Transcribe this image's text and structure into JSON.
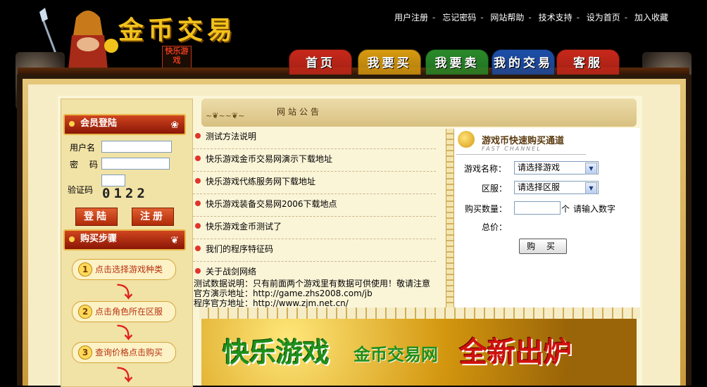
{
  "header": {
    "logo_title": "金币交易",
    "logo_badge": "快乐游戏",
    "top_links": [
      "用户注册",
      "忘记密码",
      "网站帮助",
      "技术支持",
      "设为首页",
      "加入收藏"
    ],
    "nav_tabs": [
      {
        "label": "首页",
        "color": "#c8281a"
      },
      {
        "label": "我要买",
        "color": "#d89a10"
      },
      {
        "label": "我要卖",
        "color": "#2a8a2a"
      },
      {
        "label": "我的交易",
        "color": "#1d4fa8"
      },
      {
        "label": "客服",
        "color": "#c8281a"
      }
    ]
  },
  "login": {
    "title": "会员登陆",
    "username_label": "用户名",
    "password_label": "密 码",
    "captcha_label": "验证码",
    "captcha_value": "0122",
    "login_button": "登陆",
    "register_button": "注册"
  },
  "steps": {
    "title": "购买步骤",
    "items": [
      {
        "num": "1",
        "text": "点击选择游戏种类"
      },
      {
        "num": "2",
        "text": "点击角色所在区服"
      },
      {
        "num": "3",
        "text": "查询价格点击购买"
      }
    ]
  },
  "notice": {
    "title": "网站公告",
    "items": [
      "测试方法说明",
      "快乐游戏金币交易网演示下载地址",
      "快乐游戏代练服务网下载地址",
      "快乐游戏装备交易网2006下载地点",
      "快乐游戏金币测试了",
      "我们的程序特征码",
      "关于战剑网络"
    ],
    "note_lines": [
      "测试数据说明：只有前面两个游戏里有数据可供使用！敬请注意",
      "官方演示地址：http://game.zhs2008.com/jb",
      "程序官方地址：http://www.zjm.net.cn/"
    ]
  },
  "quick_buy": {
    "title": "游戏币快速购买通道",
    "subtitle": "FAST CHANNEL",
    "game_label": "游戏名称：",
    "game_value": "请选择游戏",
    "server_label": "区服：",
    "server_value": "请选择区服",
    "quantity_label": "购买数量：",
    "quantity_unit": "个",
    "quantity_hint": "请输入数字",
    "total_label": "总价：",
    "buy_button": "购 买"
  },
  "banner": {
    "main_text": "快乐游戏",
    "sub_text": "金币交易网",
    "new_text": "全新出炉"
  }
}
